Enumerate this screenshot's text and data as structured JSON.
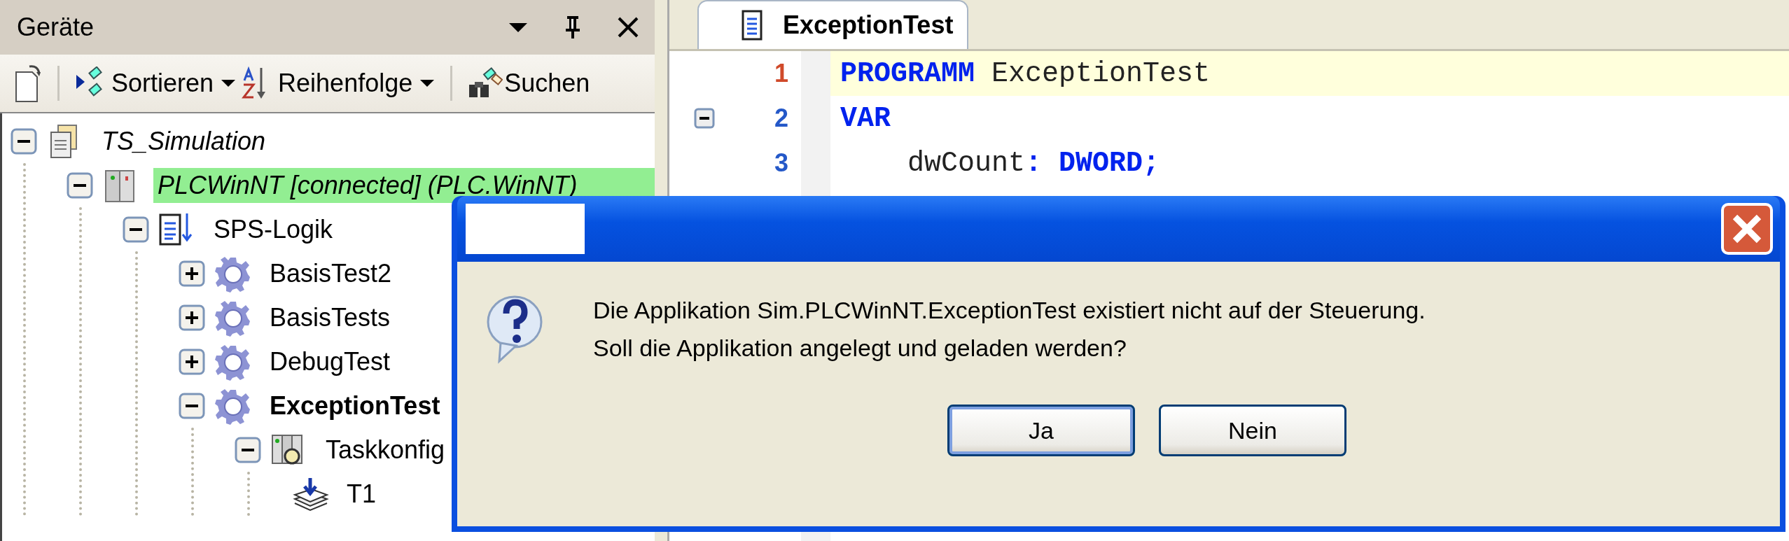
{
  "devices_panel": {
    "title": "Geräte",
    "toolbar": [
      {
        "label": "Sortieren",
        "kind": "sort",
        "dropdown": true
      },
      {
        "label": "Reihenfolge",
        "kind": "order",
        "dropdown": true
      },
      {
        "label": "Suchen",
        "kind": "search",
        "dropdown": false
      }
    ],
    "tree": [
      {
        "label": "TS_Simulation",
        "kind": "project",
        "expanded": true,
        "highlighted": false,
        "active": false,
        "children": [
          {
            "label": "PLCWinNT [connected] (PLC.WinNT)",
            "kind": "device",
            "expanded": true,
            "highlighted": true,
            "active": false,
            "children": [
              {
                "label": "SPS-Logik",
                "kind": "logic",
                "expanded": true,
                "highlighted": false,
                "active": false,
                "children": [
                  {
                    "label": "BasisTest2",
                    "kind": "application",
                    "expanded": false,
                    "highlighted": false,
                    "active": false
                  },
                  {
                    "label": "BasisTests",
                    "kind": "application",
                    "expanded": false,
                    "highlighted": false,
                    "active": false
                  },
                  {
                    "label": "DebugTest",
                    "kind": "application",
                    "expanded": false,
                    "highlighted": false,
                    "active": false
                  },
                  {
                    "label": "ExceptionTest",
                    "kind": "application",
                    "expanded": true,
                    "highlighted": false,
                    "active": true,
                    "children": [
                      {
                        "label": "Taskkonfig",
                        "kind": "task-config",
                        "expanded": true,
                        "highlighted": false,
                        "active": false,
                        "children": [
                          {
                            "label": "T1",
                            "kind": "task",
                            "highlighted": false,
                            "active": false
                          }
                        ]
                      }
                    ]
                  }
                ]
              }
            ]
          }
        ]
      }
    ]
  },
  "editor": {
    "tabs": [
      {
        "label": "ExceptionTest",
        "selected": true
      }
    ],
    "lines": [
      {
        "number": "1",
        "current": true,
        "fold": false,
        "tokens": [
          {
            "text": "PROGRAMM",
            "kind": "keyword"
          },
          {
            "text": " ExceptionTest",
            "kind": "plain"
          }
        ]
      },
      {
        "number": "2",
        "current": false,
        "fold": true,
        "tokens": [
          {
            "text": "VAR",
            "kind": "keyword"
          }
        ]
      },
      {
        "number": "3",
        "current": false,
        "fold": false,
        "tokens": [
          {
            "text": "    dwCount",
            "kind": "plain"
          },
          {
            "text": ": DWORD;",
            "kind": "keyword"
          }
        ]
      }
    ]
  },
  "dialog": {
    "message": [
      "Die Applikation Sim.PLCWinNT.ExceptionTest existiert nicht auf der Steuerung.",
      "Soll die Applikation angelegt und geladen werden?"
    ],
    "buttons": [
      {
        "label": "Ja",
        "default": true
      },
      {
        "label": "Nein",
        "default": false
      }
    ]
  }
}
